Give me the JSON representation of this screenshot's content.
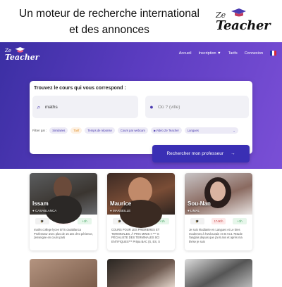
{
  "banner": {
    "line1": "Un moteur de recherche international",
    "line2": "et des annonces",
    "logo_prefix": "Ze",
    "logo_word": "Teacher"
  },
  "nav": {
    "logo_prefix": "Ze",
    "logo_word": "Teacher",
    "items": [
      "Accueil",
      "Inscription",
      "Tarifs",
      "Connexion"
    ]
  },
  "search": {
    "title": "Trouvez le cours qui vous correspond :",
    "what_value": "maths",
    "where_placeholder": "Où ? (ville)",
    "filters_label": "Filtrer par :",
    "filters": [
      "Similaires",
      "Tarif",
      "Temps de réponse",
      "Cours par webcam",
      "Vidéo Ze Teacher"
    ],
    "language_select": "Langues",
    "button_label": "Rechercher mon professeur",
    "button_arrow": "→"
  },
  "teachers": [
    {
      "name": "Issam",
      "city": "CASABLANCA",
      "stats": [
        "",
        "174€/h",
        "+1h"
      ],
      "desc": "maths college lycee BTS casablanca Professeur avec plus de 15 ans d'ex périence, j'enseigne en cours parti"
    },
    {
      "name": "Maurice",
      "city": "MARSEILLE",
      "stats": [
        "",
        "174€/h",
        "+1h"
      ],
      "desc": "COURS POUR LES PREMIERES ET TERMINALES, À PRIX MINIS !! *** S PÉCIALISTE DES TERMINALES SCI ENTIFIQUES*** Prépa BAC (S, ES, S"
    },
    {
      "name": "Sou-Nan",
      "city": "LIMAL",
      "stats": [
        "",
        "174€/h",
        "+1h"
      ],
      "desc": "Je suis étudiante en Langues et Le ttres modernes à l'UClouvain en B AC1 ?Etude l'anglais depuis que j'ai 6 ans et après ma thèse je suis"
    }
  ],
  "colors": {
    "accent": "#3a2fb4",
    "hero_start": "#3b2fa3",
    "hero_end": "#7a4fd6"
  }
}
